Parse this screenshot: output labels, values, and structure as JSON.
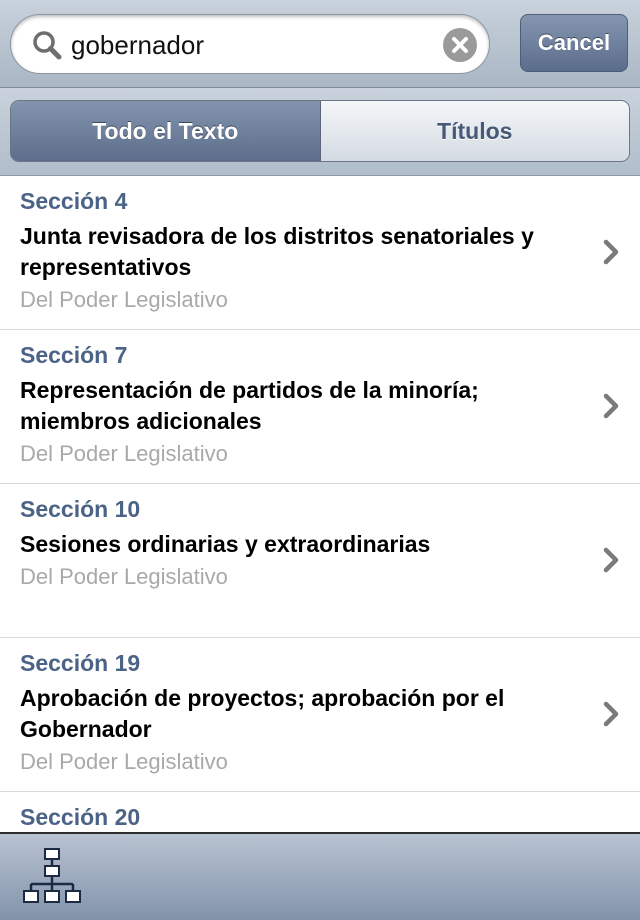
{
  "search": {
    "value": "gobernador",
    "cancel_label": "Cancel"
  },
  "segments": [
    {
      "label": "Todo el Texto",
      "selected": true
    },
    {
      "label": "Títulos",
      "selected": false
    }
  ],
  "results": [
    {
      "section": "Sección 4",
      "title": "Junta revisadora de los distritos senatoriales y representativos",
      "subtitle": "Del Poder Legislativo"
    },
    {
      "section": "Sección 7",
      "title": "Representación de partidos de la minoría; miembros adicionales",
      "subtitle": "Del Poder Legislativo"
    },
    {
      "section": "Sección 10",
      "title": "Sesiones ordinarias y extraordinarias",
      "subtitle": "Del Poder Legislativo"
    },
    {
      "section": "Sección 19",
      "title": "Aprobación de proyectos; aprobación por el Gobernador",
      "subtitle": "Del Poder Legislativo"
    },
    {
      "section": "Sección 20",
      "title": "",
      "subtitle": ""
    }
  ],
  "toolbar": {
    "icon": "hierarchy-icon"
  },
  "colors": {
    "accent": "#5d6e8c",
    "section_text": "#4b6386",
    "subtitle_text": "#a9a9a9"
  }
}
